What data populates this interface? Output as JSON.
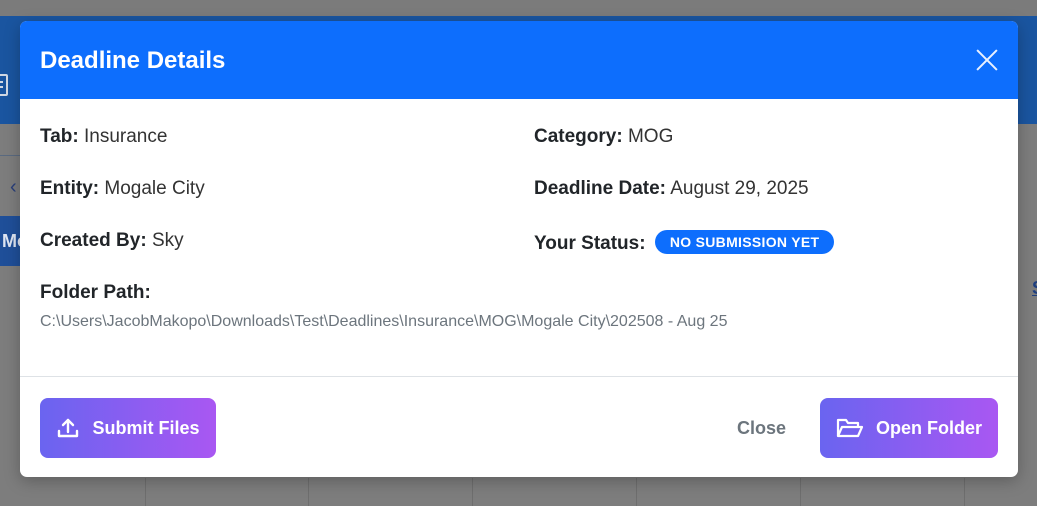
{
  "modal": {
    "title": "Deadline Details",
    "fields": {
      "tab": {
        "label": "Tab:",
        "value": "Insurance"
      },
      "category": {
        "label": "Category:",
        "value": "MOG"
      },
      "entity": {
        "label": "Entity:",
        "value": "Mogale City"
      },
      "deadline_date": {
        "label": "Deadline Date:",
        "value": "August 29, 2025"
      },
      "created_by": {
        "label": "Created By:",
        "value": "Sky"
      },
      "status": {
        "label": "Your Status:",
        "value": "NO SUBMISSION YET"
      }
    },
    "folder_path": {
      "label": "Folder Path:",
      "value": "C:\\Users\\JacobMakopo\\Downloads\\Test\\Deadlines\\Insurance\\MOG\\Mogale City\\202508 - Aug 25"
    },
    "footer": {
      "submit_label": "Submit Files",
      "close_label": "Close",
      "open_folder_label": "Open Folder"
    }
  },
  "background": {
    "tab_fragment": "Mo",
    "link_fragment": "S"
  },
  "colors": {
    "header": "#0d6efd",
    "badge": "#0d6efd",
    "button_gradient_start": "#6a64f0",
    "button_gradient_end": "#a957f2"
  },
  "icons": {
    "close": "close-icon",
    "submit": "upload-icon",
    "open_folder": "folder-open-icon"
  }
}
